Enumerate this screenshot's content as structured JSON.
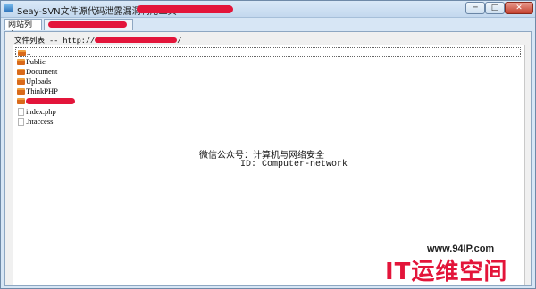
{
  "window": {
    "title": "Seay-SVN文件源代码泄露漏洞利用工具",
    "controls": {
      "minimize": "─",
      "maximize": "□",
      "close": "✕"
    }
  },
  "tabs": [
    {
      "label": "网站列表"
    },
    {
      "label": ""
    }
  ],
  "path": {
    "label": "文件列表 -- http://"
  },
  "tree": {
    "items": [
      {
        "label": "..",
        "type": "folder"
      },
      {
        "label": "Public",
        "type": "folder"
      },
      {
        "label": "Document",
        "type": "folder"
      },
      {
        "label": "Uploads",
        "type": "folder"
      },
      {
        "label": "ThinkPHP",
        "type": "folder"
      },
      {
        "label": "",
        "type": "folder"
      },
      {
        "label": "index.php",
        "type": "file"
      },
      {
        "label": ".htaccess",
        "type": "file"
      }
    ]
  },
  "info": {
    "line1": "微信公众号：计算机与网络安全",
    "line2": "ID: Computer-network"
  },
  "watermark": {
    "url": "www.94IP.com",
    "brand": "IT运维空间"
  },
  "colors": {
    "redaction": "#e3153a",
    "folder": "#d96a1a"
  }
}
